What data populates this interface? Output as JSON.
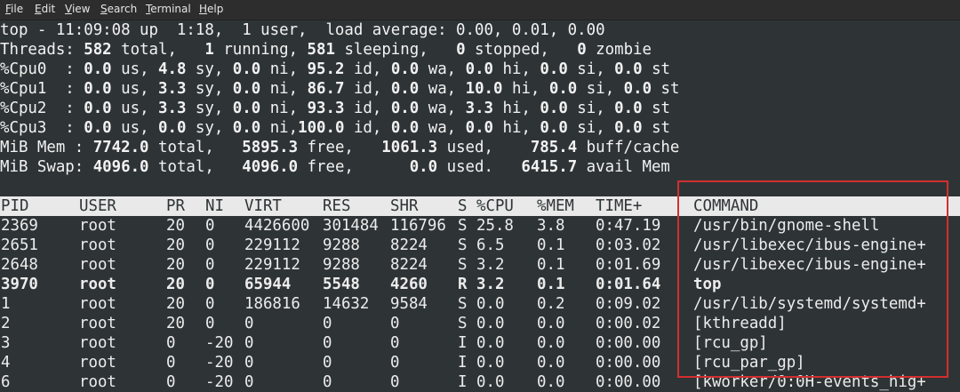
{
  "menu": {
    "file": {
      "m": "F",
      "rest": "ile"
    },
    "edit": {
      "m": "E",
      "rest": "dit"
    },
    "view": {
      "m": "V",
      "rest": "iew"
    },
    "search": {
      "m": "S",
      "rest": "earch"
    },
    "terminal": {
      "m": "T",
      "rest": "erminal"
    },
    "help": {
      "m": "H",
      "rest": "elp"
    }
  },
  "summary": {
    "top_line": "top - 11:09:08 up  1:18,  1 user,  load average: 0.00, 0.01, 0.00",
    "threads": {
      "label": "Threads: ",
      "total": "582",
      "t1": " total,   ",
      "running": "1",
      "t2": " running, ",
      "sleeping": "581",
      "t3": " sleeping,   ",
      "stopped": "0",
      "t4": " stopped,   ",
      "zombie": "0",
      "t5": " zombie"
    },
    "cpus": [
      {
        "label": "%Cpu0  : ",
        "us": "0.0",
        "sy": "4.8",
        "ni": "0.0",
        "ni_sep": " ni, ",
        "id": "95.2",
        "wa": "0.0",
        "hi": "0.0",
        "si": "0.0",
        "st": "0.0"
      },
      {
        "label": "%Cpu1  : ",
        "us": "0.0",
        "sy": "3.3",
        "ni": "0.0",
        "ni_sep": " ni, ",
        "id": "86.7",
        "wa": "0.0",
        "hi": "10.0",
        "si": "0.0",
        "st": "0.0"
      },
      {
        "label": "%Cpu2  : ",
        "us": "0.0",
        "sy": "3.3",
        "ni": "0.0",
        "ni_sep": " ni, ",
        "id": "93.3",
        "wa": "0.0",
        "hi": "3.3",
        "si": "0.0",
        "st": "0.0"
      },
      {
        "label": "%Cpu3  : ",
        "us": "0.0",
        "sy": "0.0",
        "ni": "0.0",
        "ni_sep": " ni,",
        "id": "100.0",
        "wa": "0.0",
        "hi": "0.0",
        "si": "0.0",
        "st": "0.0"
      }
    ],
    "mem": {
      "label": "MiB Mem : ",
      "total": "7742.0",
      "t1": " total,   ",
      "free": "5895.3",
      "t2": " free,   ",
      "used": "1061.3",
      "t3": " used,    ",
      "cache": "785.4",
      "t4": " buff/cache"
    },
    "swap": {
      "label": "MiB Swap: ",
      "total": "4096.0",
      "t1": " total,   ",
      "free": "4096.0",
      "t2": " free,      ",
      "used": "0.0",
      "t3": " used.   ",
      "avail": "6415.7",
      "t4": " avail Mem"
    }
  },
  "columns": {
    "pid": "PID",
    "user": "USER",
    "pr": "PR",
    "ni": "NI",
    "virt": "VIRT",
    "res": "RES",
    "shr": "SHR",
    "s": "S",
    "cpu": "%CPU",
    "mem": "%MEM",
    "time": "TIME+",
    "command": "COMMAND"
  },
  "processes": [
    {
      "pid": "2369",
      "user": "root",
      "pr": "20",
      "ni": "0",
      "virt": "4426600",
      "res": "301484",
      "shr": "116796",
      "s": "S",
      "cpu": "25.8",
      "mem": "3.8",
      "time": "0:47.19",
      "command": "/usr/bin/gnome-shell"
    },
    {
      "pid": "2651",
      "user": "root",
      "pr": "20",
      "ni": "0",
      "virt": "229112",
      "res": "9288",
      "shr": "8224",
      "s": "S",
      "cpu": "6.5",
      "mem": "0.1",
      "time": "0:03.02",
      "command": "/usr/libexec/ibus-engine+"
    },
    {
      "pid": "2648",
      "user": "root",
      "pr": "20",
      "ni": "0",
      "virt": "229112",
      "res": "9288",
      "shr": "8224",
      "s": "S",
      "cpu": "3.2",
      "mem": "0.1",
      "time": "0:01.69",
      "command": "/usr/libexec/ibus-engine+"
    },
    {
      "pid": "3970",
      "user": "root",
      "pr": "20",
      "ni": "0",
      "virt": "65944",
      "res": "5548",
      "shr": "4260",
      "s": "R",
      "cpu": "3.2",
      "mem": "0.1",
      "time": "0:01.64",
      "command": "top"
    },
    {
      "pid": "1",
      "user": "root",
      "pr": "20",
      "ni": "0",
      "virt": "186816",
      "res": "14632",
      "shr": "9584",
      "s": "S",
      "cpu": "0.0",
      "mem": "0.2",
      "time": "0:09.02",
      "command": "/usr/lib/systemd/systemd+"
    },
    {
      "pid": "2",
      "user": "root",
      "pr": "20",
      "ni": "0",
      "virt": "0",
      "res": "0",
      "shr": "0",
      "s": "S",
      "cpu": "0.0",
      "mem": "0.0",
      "time": "0:00.02",
      "command": "[kthreadd]"
    },
    {
      "pid": "3",
      "user": "root",
      "pr": "0",
      "ni": "-20",
      "virt": "0",
      "res": "0",
      "shr": "0",
      "s": "I",
      "cpu": "0.0",
      "mem": "0.0",
      "time": "0:00.00",
      "command": "[rcu_gp]"
    },
    {
      "pid": "4",
      "user": "root",
      "pr": "0",
      "ni": "-20",
      "virt": "0",
      "res": "0",
      "shr": "0",
      "s": "I",
      "cpu": "0.0",
      "mem": "0.0",
      "time": "0:00.00",
      "command": "[rcu_par_gp]"
    },
    {
      "pid": "6",
      "user": "root",
      "pr": "0",
      "ni": "-20",
      "virt": "0",
      "res": "0",
      "shr": "0",
      "s": "I",
      "cpu": "0.0",
      "mem": "0.0",
      "time": "0:00.00",
      "command": "[kworker/0:0H-events_hig+"
    }
  ],
  "colors": {
    "terminal_bg": "#2e3436",
    "header_row_bg": "#e9e9e9",
    "highlight_box": "#d32f2f"
  }
}
